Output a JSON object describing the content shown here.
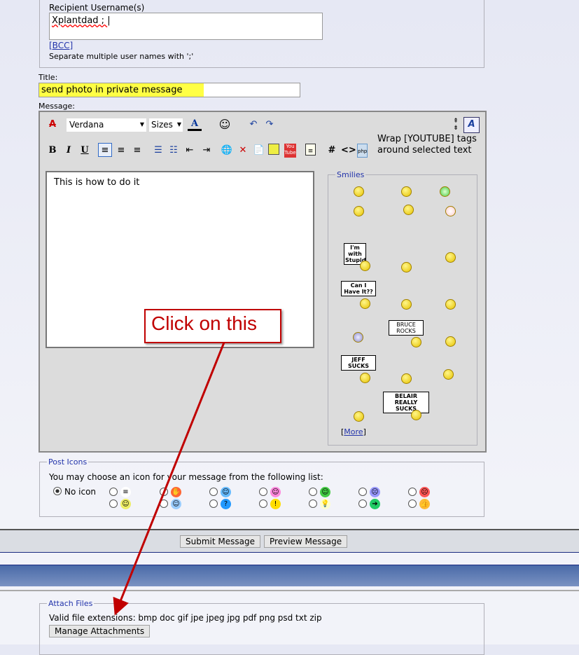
{
  "recipients": {
    "label": "Recipient Username(s)",
    "value": "Xplantdad ; ",
    "bcc_link": "[BCC]",
    "hint": "Separate multiple user names with ';'"
  },
  "title": {
    "label": "Title:",
    "value": "send photo in private message"
  },
  "message": {
    "label": "Message:",
    "body": "This is how to do it",
    "toolbar": {
      "font": "Verdana",
      "size": "Sizes",
      "youtube_tip": "Wrap [YOUTUBE] tags around selected text"
    }
  },
  "smilies": {
    "legend": "Smilies",
    "more_link": "More",
    "more_open": "[",
    "more_close": "]",
    "signs": [
      "I'm with Stupid",
      "Can I Have It??",
      "BRUCE ROCKS",
      "JEFF SUCKS",
      "BELAIR REALLY SUCKS"
    ]
  },
  "post_icons": {
    "legend": "Post Icons",
    "instruction": "You may choose an icon for your message from the following list:",
    "no_icon": "No icon",
    "selected": "No icon"
  },
  "buttons": {
    "submit": "Submit Message",
    "preview": "Preview Message"
  },
  "attach": {
    "legend": "Attach Files",
    "extensions": "Valid file extensions: bmp doc gif jpe jpeg jpg pdf png psd txt zip",
    "manage": "Manage Attachments"
  },
  "annotation": {
    "callout": "Click on this",
    "color": "#c00000"
  }
}
